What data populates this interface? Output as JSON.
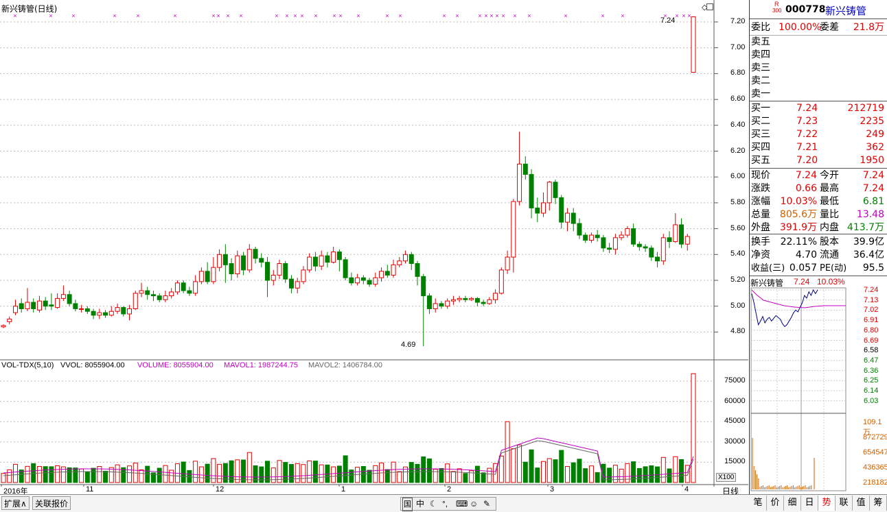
{
  "stock": {
    "title": "新兴铸管(日线)",
    "code": "000778",
    "name": "新兴铸管",
    "badge_r": "R",
    "badge_num": "300"
  },
  "main_chart": {
    "price_axis": [
      "7.20",
      "7.00",
      "6.80",
      "6.60",
      "6.40",
      "6.20",
      "6.00",
      "5.80",
      "5.60",
      "5.40",
      "5.20",
      "5.00",
      "4.80"
    ],
    "high_annot": "7.24",
    "low_annot": "4.69",
    "time_labels": [
      "2016年",
      "11",
      "12",
      "1",
      "2",
      "3",
      "4"
    ],
    "period_label": "日线"
  },
  "volume_panel": {
    "indicator": "VOL-TDX(5,10)",
    "vvol": "VVOL: 8055904.00",
    "volume": "VOLUME: 8055904.00",
    "mavol1": "MAVOL1: 1987244.75",
    "mavol2": "MAVOL2: 1406784.00",
    "axis": [
      "75000",
      "60000",
      "45000",
      "30000",
      "15000"
    ],
    "unit": "X100"
  },
  "quote": {
    "weibi_label": "委比",
    "weibi_value": "100.00%",
    "weicha_label": "委差",
    "weicha_value": "21.8万",
    "sell": [
      {
        "label": "卖五"
      },
      {
        "label": "卖四"
      },
      {
        "label": "卖三"
      },
      {
        "label": "卖二"
      },
      {
        "label": "卖一"
      }
    ],
    "buy": [
      {
        "label": "买一",
        "price": "7.24",
        "vol": "212719"
      },
      {
        "label": "买二",
        "price": "7.23",
        "vol": "2235"
      },
      {
        "label": "买三",
        "price": "7.22",
        "vol": "249"
      },
      {
        "label": "买四",
        "price": "7.21",
        "vol": "362"
      },
      {
        "label": "买五",
        "price": "7.20",
        "vol": "1950"
      }
    ],
    "stats": [
      {
        "l1": "现价",
        "v1": "7.24",
        "l2": "今开",
        "v2": "7.24"
      },
      {
        "l1": "涨跌",
        "v1": "0.66",
        "l2": "最高",
        "v2": "7.24"
      },
      {
        "l1": "涨幅",
        "v1": "10.03%",
        "l2": "最低",
        "v2": "6.81"
      },
      {
        "l1": "总量",
        "v1": "805.6万",
        "l2": "量比",
        "v2": "13.48"
      },
      {
        "l1": "外盘",
        "v1": "391.9万",
        "l2": "内盘",
        "v2": "413.7万"
      }
    ],
    "fund": [
      {
        "l1": "换手",
        "v1": "22.11%",
        "l2": "股本",
        "v2": "39.9亿"
      },
      {
        "l1": "净资",
        "v1": "4.70",
        "l2": "流通",
        "v2": "36.4亿"
      },
      {
        "l1": "收益(三)",
        "v1": "0.057",
        "l2": "PE(动)",
        "v2": "95.5"
      }
    ]
  },
  "mini_chart": {
    "name": "新兴铸管",
    "price": "7.24",
    "pct": "10.03%",
    "price_axis": [
      "7.24",
      "7.13",
      "7.02",
      "6.91",
      "6.80",
      "6.69",
      "6.58",
      "6.47",
      "6.36",
      "6.25",
      "6.14",
      "6.03"
    ],
    "vol_axis": [
      "109.1万",
      "872729",
      "654547",
      "436365",
      "218182"
    ]
  },
  "bottom_tabs": [
    "扩展∧",
    "关联报价"
  ],
  "right_tabs": [
    "笔",
    "价",
    "细",
    "日",
    "势",
    "联",
    "值",
    "筹"
  ],
  "toolbar_icons": [
    "国",
    "中"
  ],
  "colors": {
    "up": "#e00000",
    "down": "#008000",
    "ma1": "#c000c0",
    "grid": "#c0c0c0"
  }
}
